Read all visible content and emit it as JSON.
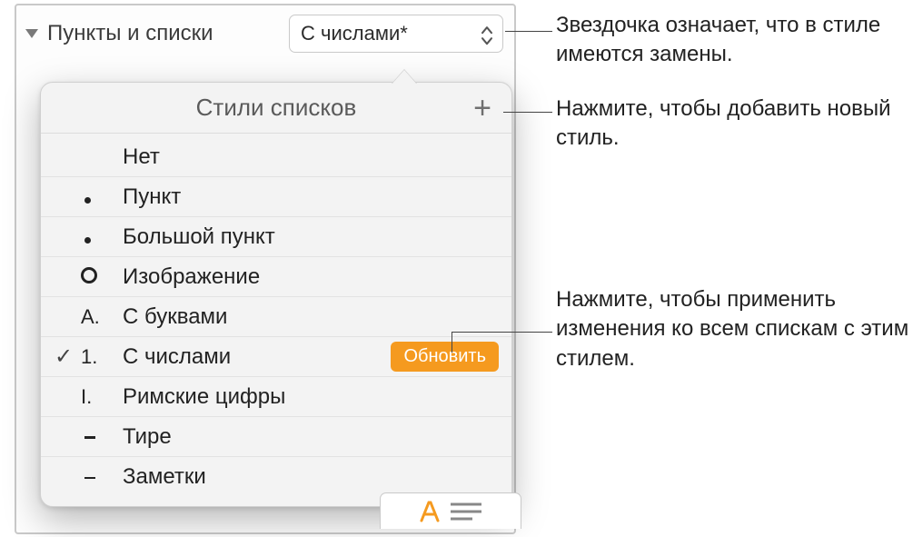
{
  "section": {
    "title": "Пункты и списки",
    "selected_style": "С числами*"
  },
  "popover": {
    "title": "Стили списков",
    "update_label": "Обновить",
    "items": [
      {
        "marker": "",
        "label": "Нет",
        "kind": "none"
      },
      {
        "marker": "bullet",
        "label": "Пункт",
        "kind": "bullet"
      },
      {
        "marker": "bullet",
        "label": "Большой пункт",
        "kind": "bullet"
      },
      {
        "marker": "circle",
        "label": "Изображение",
        "kind": "image"
      },
      {
        "marker": "A.",
        "label": "С буквами",
        "kind": "text"
      },
      {
        "marker": "1.",
        "label": "С числами",
        "kind": "text",
        "selected": true,
        "has_update": true
      },
      {
        "marker": "I.",
        "label": "Римские цифры",
        "kind": "text"
      },
      {
        "marker": "dash",
        "label": "Тире",
        "kind": "dash"
      },
      {
        "marker": "dash",
        "label": "Заметки",
        "kind": "dash"
      }
    ]
  },
  "callouts": {
    "asterisk": "Звездочка означает, что в стиле имеются замены.",
    "add": "Нажмите, чтобы добавить новый стиль.",
    "update": "Нажмите, чтобы применить изменения ко всем спискам с этим стилем."
  }
}
